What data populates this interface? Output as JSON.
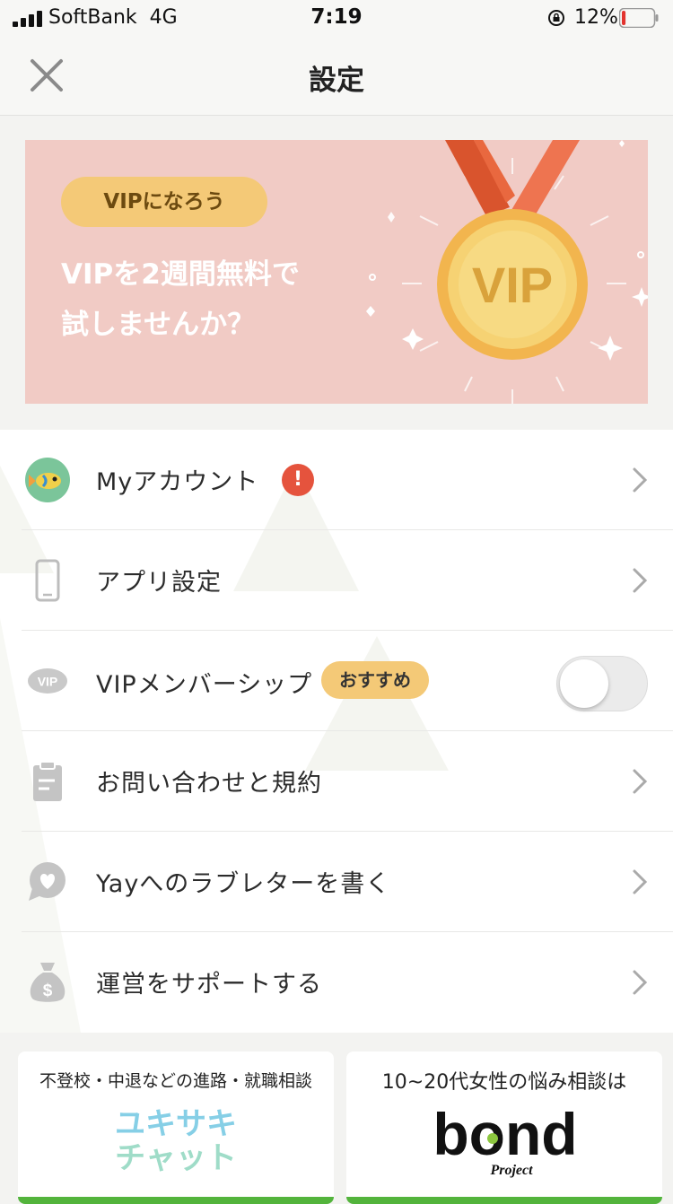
{
  "status_bar": {
    "carrier": "SoftBank",
    "network": "4G",
    "time": "7:19",
    "battery_percent": "12%",
    "battery_level": 0.12,
    "signal_bars": 4
  },
  "nav": {
    "title": "設定",
    "close_icon": "close-icon"
  },
  "banner": {
    "pill": "VIPになろう",
    "headline_line1": "VIPを2週間無料で",
    "headline_line2": "試しませんか？",
    "medal_text": "VIP",
    "bg_color": "#f1cbc5"
  },
  "menu": {
    "items": [
      {
        "label": "Myアカウント",
        "icon": "avatar-fish-icon",
        "badge": "!"
      },
      {
        "label": "アプリ設定",
        "icon": "phone-icon"
      },
      {
        "label": "VIPメンバーシップ",
        "icon": "vip-icon",
        "icon_text": "VIP",
        "badge": "おすすめ",
        "toggle_on": false
      },
      {
        "label": "お問い合わせと規約",
        "icon": "clipboard-icon"
      },
      {
        "label": "Yayへのラブレターを書く",
        "icon": "heart-bubble-icon"
      },
      {
        "label": "運営をサポートする",
        "icon": "money-bag-icon"
      }
    ]
  },
  "ads": [
    {
      "caption": "不登校・中退などの進路・就職相談",
      "logo_line1": "ユキサキ",
      "logo_line2": "チャット"
    },
    {
      "caption": "10~20代女性の悩み相談は",
      "logo": "bond",
      "logo_sub": "Project"
    }
  ],
  "colors": {
    "accent_yellow": "#f4c977",
    "alert_red": "#e5533d",
    "ad_green": "#53b43c"
  }
}
